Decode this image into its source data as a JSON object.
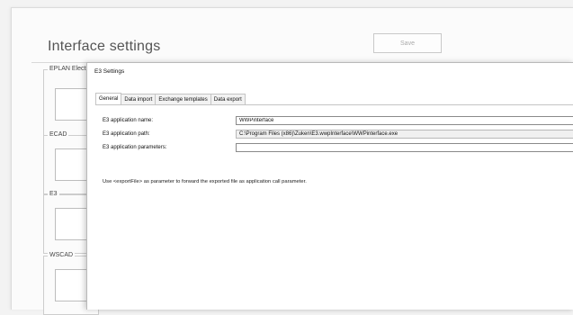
{
  "page": {
    "title": "Interface settings",
    "save_label": "Save"
  },
  "sidebar_groups": [
    {
      "label": "EPLAN Electri"
    },
    {
      "label": "ECAD"
    },
    {
      "label": "E3"
    },
    {
      "label": "WSCAD"
    }
  ],
  "dialog": {
    "title": "E3 Settings",
    "tabs": [
      {
        "label": "General"
      },
      {
        "label": "Data import"
      },
      {
        "label": "Exchange templates"
      },
      {
        "label": "Data export"
      }
    ],
    "active_tab": "General",
    "fields": {
      "app_name_label": "E3 application name:",
      "app_name_value": "WWPinterface",
      "app_path_label": "E3 application path:",
      "app_path_value": "C:\\Program Files (x86)\\Zuken\\E3.wwpInterface\\WWPinterface.exe",
      "app_params_label": "E3 application parameters:",
      "app_params_value": ""
    },
    "hint": "Use <exportFile> as parameter to forward the exported file as application call parameter."
  }
}
